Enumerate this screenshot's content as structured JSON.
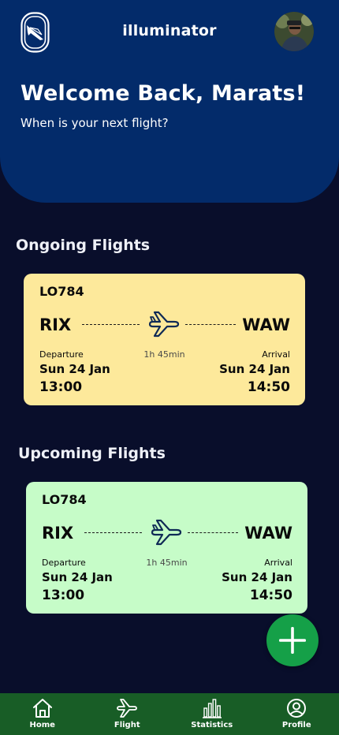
{
  "app": {
    "title": "illuminator"
  },
  "header": {
    "welcome": "Welcome Back, Marats!",
    "subtitle": "When is your next flight?"
  },
  "sections": {
    "ongoing_title": "Ongoing Flights",
    "upcoming_title": "Upcoming Flights"
  },
  "ongoing": {
    "flight_number": "LO784",
    "from": "RIX",
    "to": "WAW",
    "duration": "1h 45min",
    "departure_label": "Departure",
    "arrival_label": "Arrival",
    "departure_date": "Sun 24 Jan",
    "arrival_date": "Sun 24 Jan",
    "departure_time": "13:00",
    "arrival_time": "14:50"
  },
  "upcoming": {
    "flight_number": "LO784",
    "from": "RIX",
    "to": "WAW",
    "duration": "1h 45min",
    "departure_label": "Departure",
    "arrival_label": "Arrival",
    "departure_date": "Sun 24 Jan",
    "arrival_date": "Sun 24 Jan",
    "departure_time": "13:00",
    "arrival_time": "14:50"
  },
  "nav": {
    "items": [
      {
        "label": "Home",
        "icon": "home-icon"
      },
      {
        "label": "Flight",
        "icon": "flight-icon"
      },
      {
        "label": "Statistics",
        "icon": "statistics-icon"
      },
      {
        "label": "Profile",
        "icon": "profile-icon"
      }
    ]
  },
  "colors": {
    "background": "#090e2b",
    "hero": "#032b6a",
    "ongoing_card": "#fde99b",
    "upcoming_card": "#c6fcc8",
    "fab": "#15a048",
    "nav_bar": "#185d26",
    "plane": "#0f2a55"
  }
}
